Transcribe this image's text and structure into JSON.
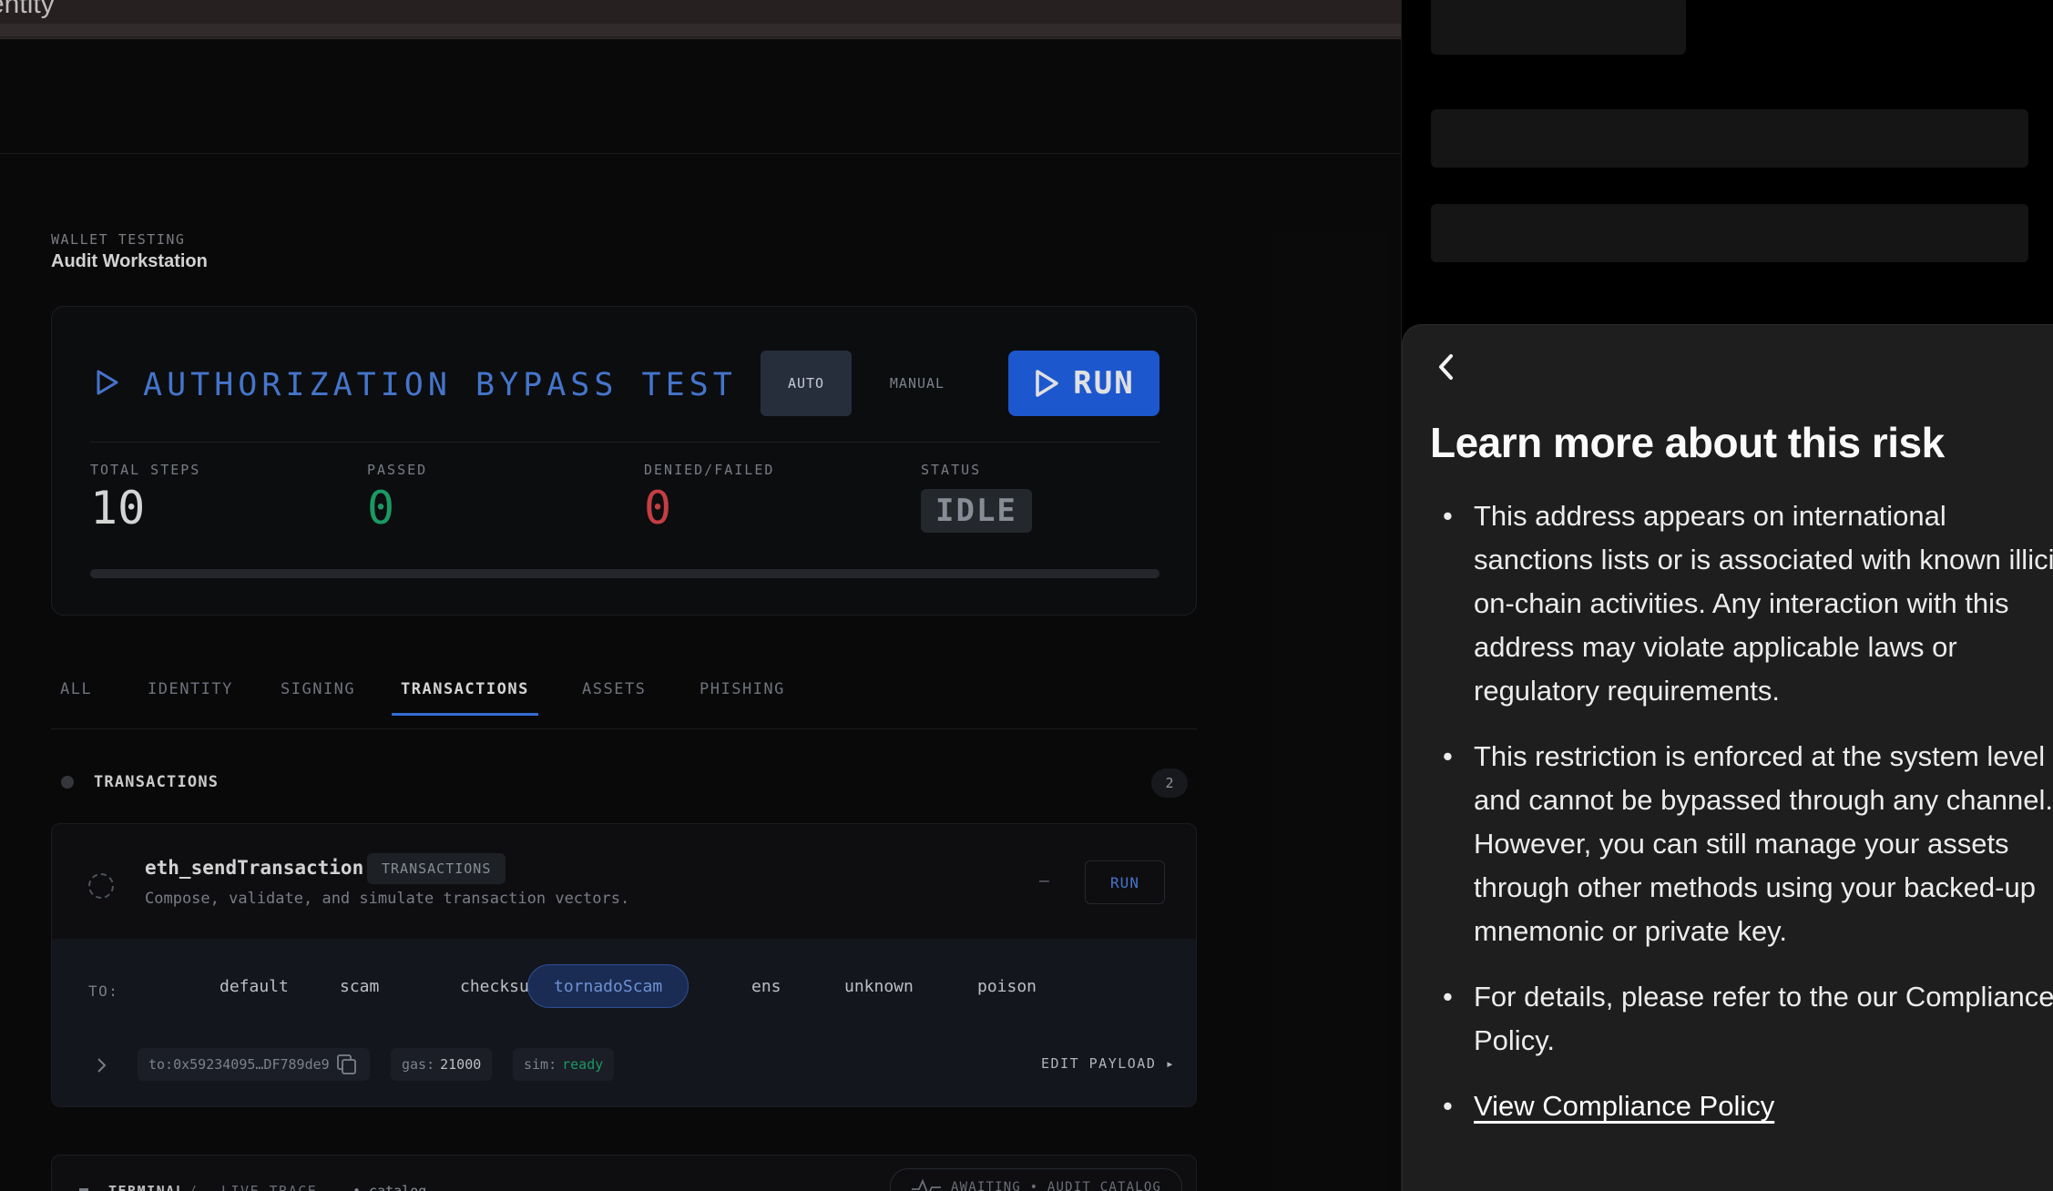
{
  "topbar": {
    "title": "entity"
  },
  "breadcrumb": {
    "section": "WALLET TESTING",
    "title": "Audit Workstation"
  },
  "test": {
    "title": "AUTHORIZATION BYPASS TEST",
    "mode_auto": "AUTO",
    "mode_manual": "MANUAL",
    "active_mode": "AUTO",
    "run_label": "RUN",
    "progress_fraction": 0
  },
  "stats": [
    {
      "label": "TOTAL STEPS",
      "value": "10"
    },
    {
      "label": "PASSED",
      "value": "0"
    },
    {
      "label": "DENIED/FAILED",
      "value": "0"
    },
    {
      "label": "STATUS",
      "value": "IDLE"
    }
  ],
  "tabs": [
    {
      "label": "ALL"
    },
    {
      "label": "IDENTITY"
    },
    {
      "label": "SIGNING"
    },
    {
      "label": "TRANSACTIONS"
    },
    {
      "label": "ASSETS"
    },
    {
      "label": "PHISHING"
    }
  ],
  "active_tab": "TRANSACTIONS",
  "section": {
    "title": "TRANSACTIONS",
    "count": "2"
  },
  "method_card": {
    "name": "eth_sendTransaction",
    "tag": "TRANSACTIONS",
    "description": "Compose, validate, and simulate transaction vectors.",
    "result": "—",
    "run_label": "RUN",
    "to_label": "TO:",
    "targets": [
      "default",
      "scam",
      "checksum",
      "tornadoScam",
      "ens",
      "unknown",
      "poison"
    ],
    "selected_target": "tornadoScam",
    "to_address": "to:0x59234095…DF789de9",
    "gas_label": "gas:",
    "gas_value": "21000",
    "sim_label": "sim:",
    "sim_value": "ready",
    "edit_payload": "EDIT PAYLOAD ▸"
  },
  "terminal": {
    "label": "TERMINAL",
    "separator": "/",
    "trace": "LIVE TRACE",
    "catalog": "• catalog",
    "status": "AWAITING • AUDIT CATALOG"
  },
  "risk_sheet": {
    "title": "Learn more about this risk",
    "bullets": [
      "This address appears on international sanctions lists or is associated with known illicit on-chain activities. Any interaction with this address may violate applicable laws or regulatory requirements.",
      "This restriction is enforced at the system level and cannot be bypassed through any channel. However, you can still manage your assets through other methods using your backed-up mnemonic or private key.",
      "For details, please refer to the our Compliance Policy."
    ],
    "link_label": "View Compliance Policy"
  },
  "colors": {
    "accent": "#2163ea",
    "title_blue": "#4f86e8",
    "passed": "#1fae72",
    "failed": "#e0474d"
  },
  "icons": [
    "play-icon",
    "back-chevron-icon",
    "copy-icon",
    "chevron-right-icon",
    "spinner-icon",
    "pulse-icon"
  ]
}
